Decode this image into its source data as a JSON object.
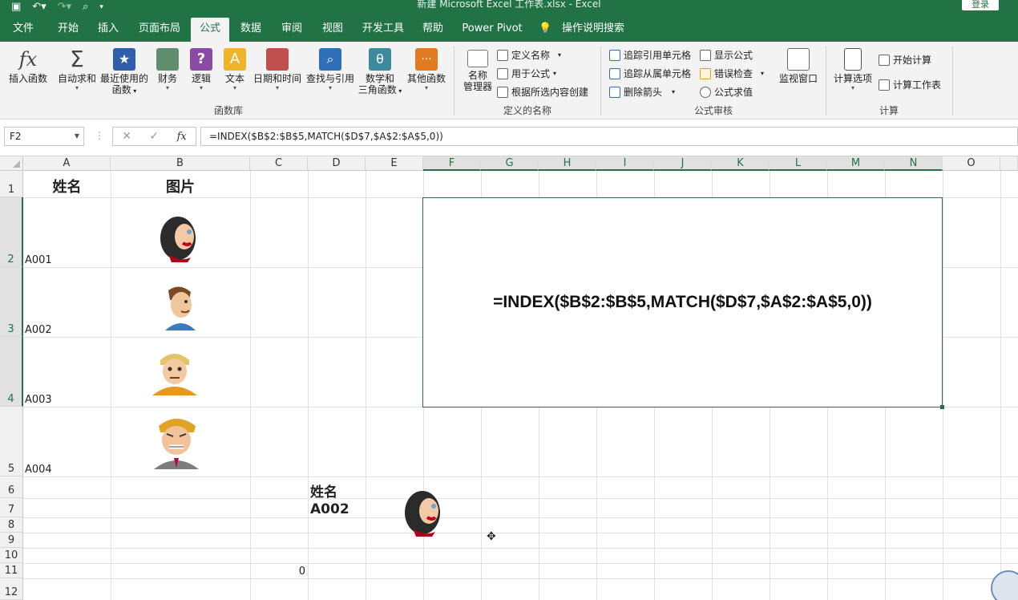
{
  "titlebar": {
    "title": "新建 Microsoft Excel 工作表.xlsx  -  Excel",
    "login": "登录"
  },
  "tabs": [
    {
      "label": "文件",
      "x": 0
    },
    {
      "label": "开始"
    },
    {
      "label": "插入"
    },
    {
      "label": "页面布局"
    },
    {
      "label": "公式",
      "active": true
    },
    {
      "label": "数据"
    },
    {
      "label": "审阅"
    },
    {
      "label": "视图"
    },
    {
      "label": "开发工具"
    },
    {
      "label": "帮助"
    },
    {
      "label": "Power Pivot"
    },
    {
      "label": "操作说明搜索"
    }
  ],
  "ribbon": {
    "insert_function": "插入函数",
    "autosum": "自动求和",
    "recent1": "最近使用的",
    "recent2": "函数",
    "financial": "财务",
    "logical": "逻辑",
    "text": "文本",
    "datetime": "日期和时间",
    "lookup": "查找与引用",
    "math1": "数学和",
    "math2": "三角函数",
    "other": "其他函数",
    "group_library": "函数库",
    "name_mgr1": "名称",
    "name_mgr2": "管理器",
    "define_name": "定义名称",
    "use_in_formula": "用于公式",
    "create_from_sel": "根据所选内容创建",
    "group_names": "定义的名称",
    "trace_precedents": "追踪引用单元格",
    "trace_dependents": "追踪从属单元格",
    "remove_arrows": "删除箭头",
    "show_formulas": "显示公式",
    "error_check": "错误检查",
    "evaluate": "公式求值",
    "watch_window": "监视窗口",
    "group_audit": "公式审核",
    "calc_options": "计算选项",
    "calc_now": "开始计算",
    "calc_sheet": "计算工作表",
    "group_calc": "计算"
  },
  "formula_bar": {
    "name_box": "F2",
    "formula": "=INDEX($B$2:$B$5,MATCH($D$7,$A$2:$A$5,0))",
    "fx": "fx"
  },
  "columns": [
    "A",
    "B",
    "C",
    "D",
    "E",
    "F",
    "G",
    "H",
    "I",
    "J",
    "K",
    "L",
    "M",
    "N",
    "O"
  ],
  "rows": [
    "1",
    "2",
    "3",
    "4",
    "5",
    "6",
    "7",
    "8",
    "9",
    "10",
    "11",
    "12"
  ],
  "cells": {
    "A1": "姓名",
    "B1": "图片",
    "A2": "A001",
    "A3": "A002",
    "A4": "A003",
    "A5": "A004",
    "D6": "姓名",
    "D7": "A002",
    "C11": "0"
  },
  "textbox": "=INDEX($B$2:$B$5,MATCH($D$7,$A$2:$A$5,0))",
  "colors": {
    "excel_green": "#217346",
    "ribbon_bg": "#f3f3f3"
  }
}
